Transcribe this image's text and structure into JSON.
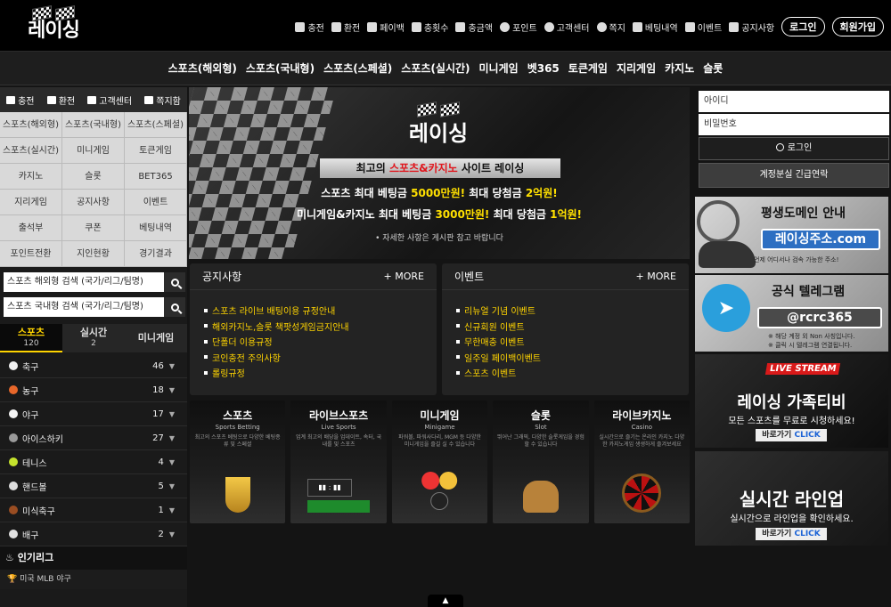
{
  "brand": {
    "logo_text": "레이싱"
  },
  "topmenu": [
    {
      "label": "충전",
      "icon": "card-icon"
    },
    {
      "label": "환전",
      "icon": "cash-icon"
    },
    {
      "label": "페이백",
      "icon": "payback-icon"
    },
    {
      "label": "충횟수",
      "icon": "chart-icon"
    },
    {
      "label": "충금액",
      "icon": "coin-icon"
    },
    {
      "label": "포인트",
      "icon": "point-icon"
    },
    {
      "label": "고객센터",
      "icon": "headset-icon"
    },
    {
      "label": "쪽지",
      "icon": "message-icon"
    },
    {
      "label": "베팅내역",
      "icon": "list-icon"
    },
    {
      "label": "이벤트",
      "icon": "gift-icon"
    },
    {
      "label": "공지사항",
      "icon": "megaphone-icon"
    }
  ],
  "auth": {
    "login": "로그인",
    "register": "회원가입"
  },
  "mainnav": [
    "스포츠(해외형)",
    "스포츠(국내형)",
    "스포츠(스페셜)",
    "스포츠(실시간)",
    "미니게임",
    "벳365",
    "토큰게임",
    "지리게임",
    "카지노",
    "슬롯"
  ],
  "quickbar": [
    {
      "label": "충전",
      "icon": "card-icon"
    },
    {
      "label": "환전",
      "icon": "cash-icon"
    },
    {
      "label": "고객센터",
      "icon": "headset-icon"
    },
    {
      "label": "쪽지함",
      "icon": "message-icon"
    }
  ],
  "grid": [
    "스포츠(해외형)",
    "스포츠(국내형)",
    "스포츠(스페셜)",
    "스포츠(실시간)",
    "미니게임",
    "토큰게임",
    "카지노",
    "슬롯",
    "BET365",
    "지리게임",
    "공지사항",
    "이벤트",
    "출석부",
    "쿠폰",
    "베팅내역",
    "포인트전환",
    "지인현황",
    "경기결과"
  ],
  "search": {
    "overseas_placeholder": "스포츠 해외형 검색 (국가/리그/팀명)",
    "domestic_placeholder": "스포츠 국내형 검색 (국가/리그/팀명)"
  },
  "sport_tabs": [
    {
      "label": "스포츠",
      "count": "120"
    },
    {
      "label": "실시간",
      "count": "2"
    },
    {
      "label": "미니게임",
      "count": ""
    }
  ],
  "sports": [
    {
      "name": "축구",
      "count": "46",
      "color": "#f2f2f2"
    },
    {
      "name": "농구",
      "count": "18",
      "color": "#e8672a"
    },
    {
      "name": "야구",
      "count": "17",
      "color": "#f5f5f5"
    },
    {
      "name": "아이스하키",
      "count": "27",
      "color": "#9a9a9a"
    },
    {
      "name": "테니스",
      "count": "4",
      "color": "#c5e32d"
    },
    {
      "name": "핸드볼",
      "count": "5",
      "color": "#dddddd"
    },
    {
      "name": "미식축구",
      "count": "1",
      "color": "#9a4d22"
    },
    {
      "name": "배구",
      "count": "2",
      "color": "#e0e0e0"
    }
  ],
  "popular": {
    "title": "인기리그",
    "item": "미국 MLB 야구"
  },
  "banner": {
    "logo_text": "레이싱",
    "head_pre": "최고의 ",
    "head_hl": "스포츠&카지노",
    "head_post": " 사이트 레이싱",
    "line1_pre": "스포츠 최대 베팅금 ",
    "line1_a": "5000만원!",
    "line1_mid": " 최대 당첨금 ",
    "line1_b": "2억원!",
    "line2_pre": "미니게임&카지노 최대 베팅금 ",
    "line2_a": "3000만원!",
    "line2_mid": " 최대 당첨금 ",
    "line2_b": "1억원!",
    "note": "• 자세한 사항은 게시판 참고 바랍니다"
  },
  "notice": {
    "title": "공지사항",
    "more": "+ MORE",
    "items": [
      "스포츠 라이브 배팅이용 규정안내",
      "해외카지노,슬롯 책팟성게임금지안내",
      "단폴더 이용규정",
      "코인충전 주의사항",
      "롤링규정"
    ]
  },
  "event": {
    "title": "이벤트",
    "more": "+ MORE",
    "items": [
      "리뉴얼 기념 이벤트",
      "신규회원 이벤트",
      "무한매충 이벤트",
      "일주일 페이백이벤트",
      "스포츠 이벤트"
    ]
  },
  "games": [
    {
      "title": "스포츠",
      "sub": "Sports Betting",
      "desc": "최고의 스포츠 베팅으로 다양한 베팅종류 및 스페셜"
    },
    {
      "title": "라이브스포츠",
      "sub": "Live Sports",
      "desc": "업계 최고의 배당을 업데이트, 속터, 국내를 및 스포츠"
    },
    {
      "title": "미니게임",
      "sub": "Minigame",
      "desc": "파워볼, 파워사다리, MGM 등 다양한 미니게임을 즐길 실 수 있습니다"
    },
    {
      "title": "슬롯",
      "sub": "Slot",
      "desc": "뛰어난 그래픽, 다양한 슬롯게임을 경험할 수 있습니다"
    },
    {
      "title": "라이브카지노",
      "sub": "Casino",
      "desc": "실시간으로 즐기는 온라인 카지노 다양한 카지노게임 생생하게 즐겨보세요"
    }
  ],
  "login_box": {
    "id_placeholder": "아이디",
    "pw_placeholder": "비밀번호",
    "login": "로그인",
    "lost": "계정분실 긴급연락"
  },
  "ads": {
    "domain": {
      "title": "평생도메인 안내",
      "box": "레이싱주소.com",
      "note": "언제 어디서나 검속 가능한 주소!"
    },
    "telegram": {
      "title": "공식 텔레그램",
      "box": "@rcrc365",
      "note1": "※ 해당 계정 외 Non 사칭입니다.",
      "note2": "※ 클릭 시 텔레그램 연결됩니다."
    },
    "tv": {
      "badge": "LIVE STREAM",
      "title": "레이싱 가족티비",
      "sub": "모든 스포츠를 무료로 시청하세요!",
      "go": "바로가기",
      "click": "CLICK"
    },
    "lineup": {
      "title": "실시간 라인업",
      "sub": "실시간으로 라인업을 확인하세요.",
      "go": "바로가기",
      "click": "CLICK"
    }
  }
}
